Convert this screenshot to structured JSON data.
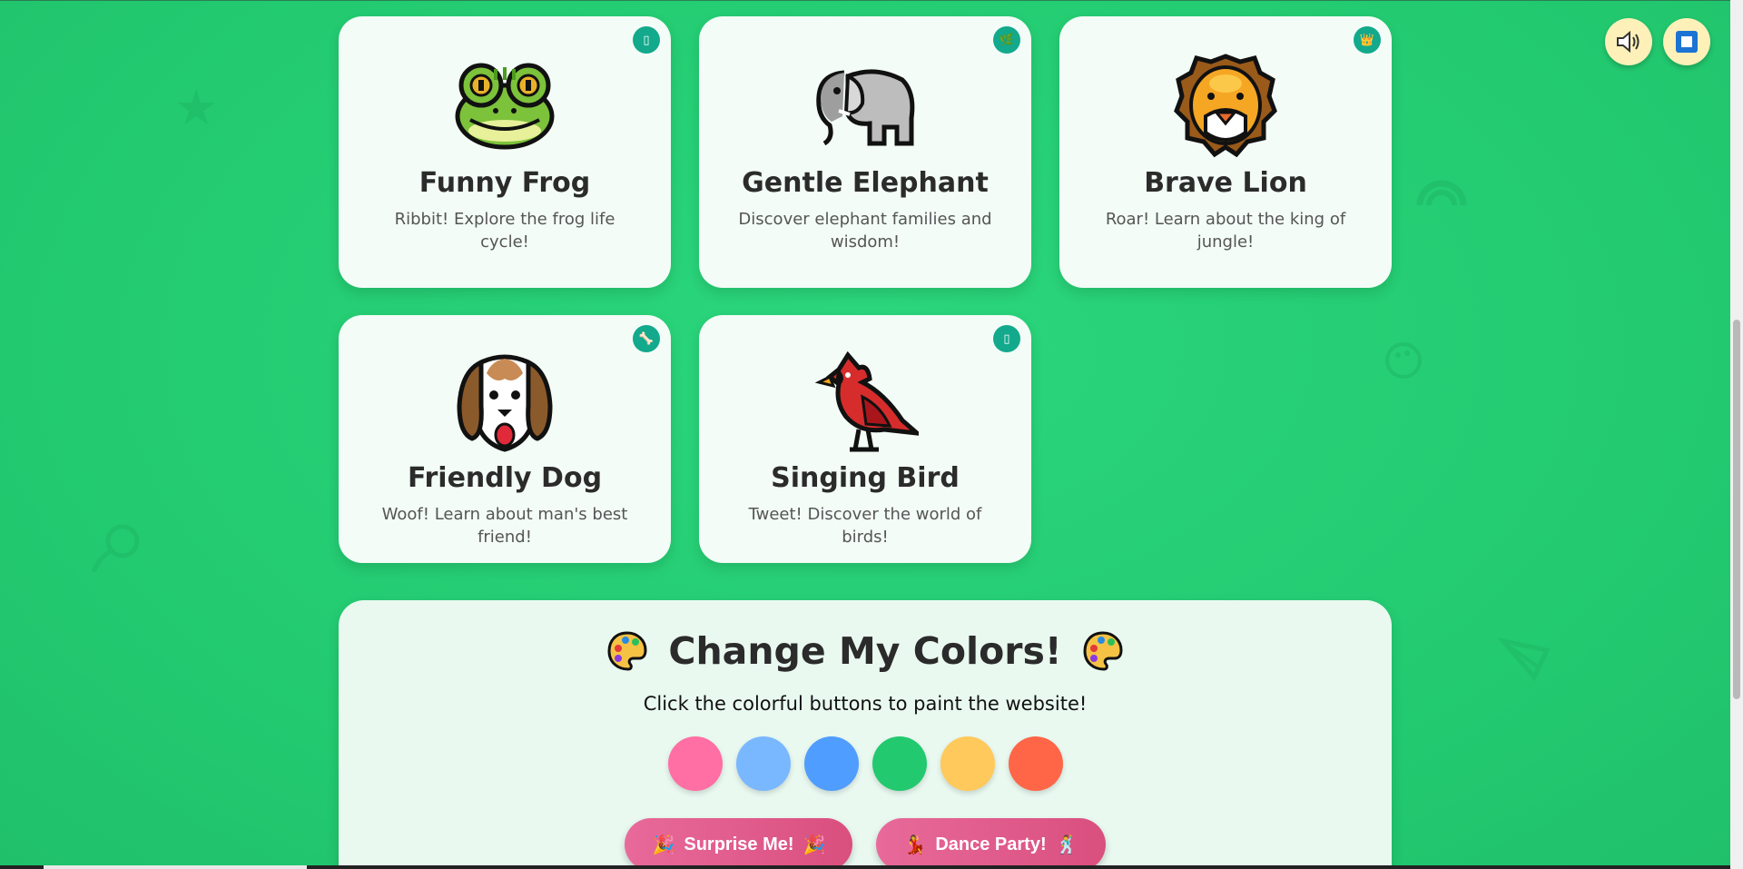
{
  "cards": [
    {
      "title": "Funny Frog",
      "desc": "Ribbit! Explore the frog life cycle!",
      "badge": "▯",
      "emoji": "frog"
    },
    {
      "title": "Gentle Elephant",
      "desc": "Discover elephant families and wisdom!",
      "badge": "🌿",
      "emoji": "elephant"
    },
    {
      "title": "Brave Lion",
      "desc": "Roar! Learn about the king of jungle!",
      "badge": "👑",
      "emoji": "lion"
    },
    {
      "title": "Friendly Dog",
      "desc": "Woof! Learn about man's best friend!",
      "badge": "🦴",
      "emoji": "dog"
    },
    {
      "title": "Singing Bird",
      "desc": "Tweet! Discover the world of birds!",
      "badge": "▯",
      "emoji": "bird"
    }
  ],
  "colors": {
    "title": "Change My Colors!",
    "subtitle": "Click the colorful buttons to paint the website!",
    "swatches": [
      "#ff6fa3",
      "#79b8ff",
      "#4f9dff",
      "#22c96f",
      "#ffc95b",
      "#ff6647"
    ],
    "surprise_label": "Surprise Me!",
    "dance_label": "Dance Party!"
  },
  "controls": {
    "sound_icon": "speaker-icon",
    "stop_icon": "stop-icon"
  }
}
